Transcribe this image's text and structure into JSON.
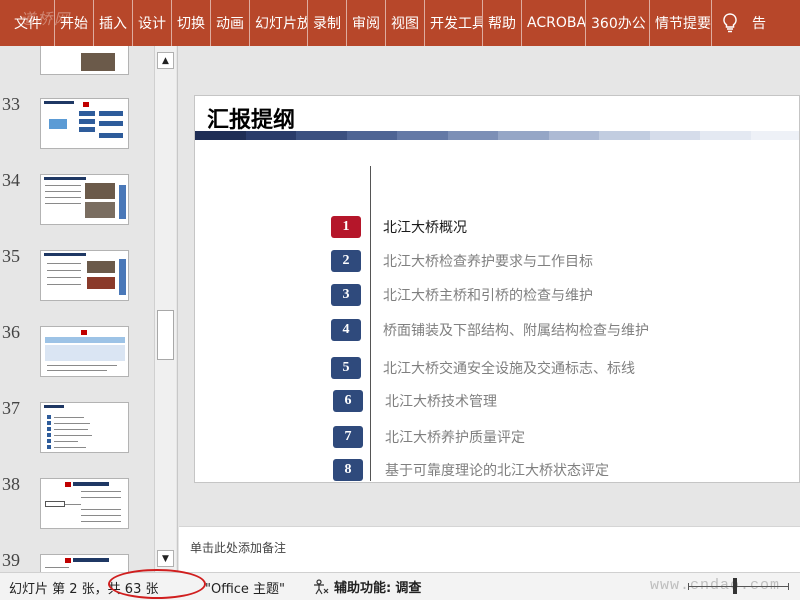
{
  "ribbon": {
    "tabs": [
      "文件",
      "开始",
      "插入",
      "设计",
      "切换",
      "动画",
      "幻灯片放映",
      "录制",
      "审阅",
      "视图",
      "开发工具",
      "帮助",
      "ACROBAT",
      "360办公",
      "情节提要"
    ],
    "tell_me": "告",
    "watermark": "道桥网",
    "colors": {
      "ribbon": "#b7472a"
    }
  },
  "thumbnails": {
    "numbers": [
      "33",
      "34",
      "35",
      "36",
      "37",
      "38",
      "39"
    ]
  },
  "slide": {
    "title": "汇报提纲",
    "items": [
      {
        "num": "1",
        "label": "北江大桥概况",
        "active": true
      },
      {
        "num": "2",
        "label": "北江大桥检查养护要求与工作目标",
        "active": false
      },
      {
        "num": "3",
        "label": "北江大桥主桥和引桥的检查与维护",
        "active": false
      },
      {
        "num": "4",
        "label": "桥面铺装及下部结构、附属结构检查与维护",
        "active": false
      },
      {
        "num": "5",
        "label": "北江大桥交通安全设施及交通标志、标线",
        "active": false
      },
      {
        "num": "6",
        "label": "北江大桥技术管理",
        "active": false
      },
      {
        "num": "7",
        "label": "北江大桥养护质量评定",
        "active": false
      },
      {
        "num": "8",
        "label": "基于可靠度理论的北江大桥状态评定",
        "active": false
      }
    ],
    "colors": {
      "active": "#b5162a",
      "inactive": "#2f4a7c"
    }
  },
  "notes": {
    "placeholder": "单击此处添加备注"
  },
  "status": {
    "slide_info": "幻灯片 第 2 张，共 63 张",
    "theme": "\"Office 主题\"",
    "accessibility_label": "辅助功能:",
    "accessibility_value": "调查",
    "watermark": "www.cndao.com"
  }
}
